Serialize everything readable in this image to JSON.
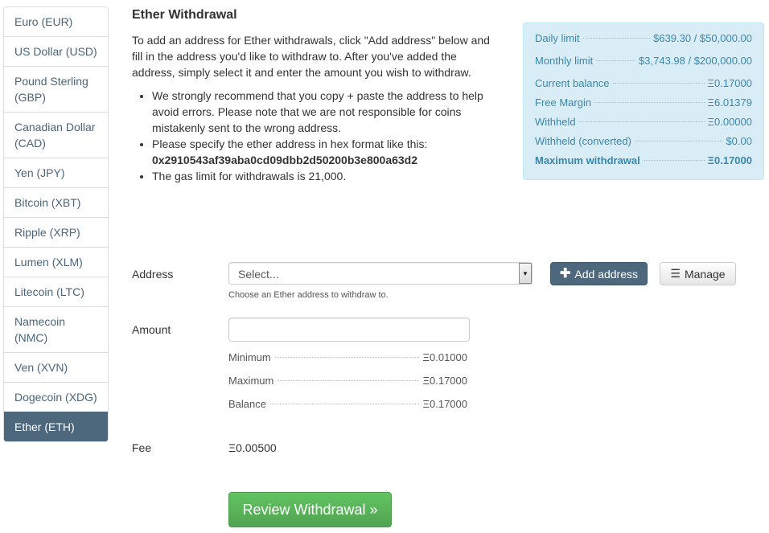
{
  "sidebar": {
    "items": [
      {
        "label": "Euro (EUR)",
        "active": false
      },
      {
        "label": "US Dollar (USD)",
        "active": false
      },
      {
        "label": "Pound Sterling (GBP)",
        "active": false
      },
      {
        "label": "Canadian Dollar (CAD)",
        "active": false
      },
      {
        "label": "Yen (JPY)",
        "active": false
      },
      {
        "label": "Bitcoin (XBT)",
        "active": false
      },
      {
        "label": "Ripple (XRP)",
        "active": false
      },
      {
        "label": "Lumen (XLM)",
        "active": false
      },
      {
        "label": "Litecoin (LTC)",
        "active": false
      },
      {
        "label": "Namecoin (NMC)",
        "active": false
      },
      {
        "label": "Ven (XVN)",
        "active": false
      },
      {
        "label": "Dogecoin (XDG)",
        "active": false
      },
      {
        "label": "Ether (ETH)",
        "active": true
      }
    ]
  },
  "main": {
    "title": "Ether Withdrawal",
    "intro": "To add an address for Ether withdrawals, click \"Add address\" below and fill in the address you'd like to withdraw to. After you've added the address, simply select it and enter the amount you wish to withdraw.",
    "bullets": {
      "b1": "We strongly recommend that you copy + paste the address to help avoid errors. Please note that we are not responsible for coins mistakenly sent to the wrong address.",
      "b2": "Please specify the ether address in hex format like this:",
      "b2_hex": "0x2910543af39aba0cd09dbb2d50200b3e800a63d2",
      "b3": "The gas limit for withdrawals is 21,000."
    }
  },
  "limits": {
    "rows": [
      {
        "label": "Daily limit",
        "value": "$639.30 / $50,000.00"
      },
      {
        "label": "Monthly limit",
        "value": "$3,743.98 / $200,000.00"
      },
      {
        "label": "Current balance",
        "value": "Ξ0.17000"
      },
      {
        "label": "Free Margin",
        "value": "Ξ6.01379"
      },
      {
        "label": "Withheld",
        "value": "Ξ0.00000"
      },
      {
        "label": "Withheld (converted)",
        "value": "$0.00"
      },
      {
        "label": "Maximum withdrawal",
        "value": "Ξ0.17000"
      }
    ]
  },
  "form": {
    "address_label": "Address",
    "address_select_value": "Select...",
    "address_help": "Choose an Ether address to withdraw to.",
    "add_address_label": "Add address",
    "manage_label": "Manage",
    "amount_label": "Amount",
    "amount_value": "",
    "minmax": [
      {
        "label": "Minimum",
        "value": "Ξ0.01000"
      },
      {
        "label": "Maximum",
        "value": "Ξ0.17000"
      },
      {
        "label": "Balance",
        "value": "Ξ0.17000"
      }
    ],
    "fee_label": "Fee",
    "fee_value": "Ξ0.00500",
    "review_label": "Review Withdrawal »"
  },
  "icons": {
    "plus": "plus-icon",
    "list": "list-icon",
    "caret": "caret-down-icon"
  },
  "colors": {
    "sidebar_active_bg": "#4d687c",
    "info_panel_bg": "#d9edf7",
    "info_panel_text": "#3a87ad",
    "review_button": "#5cb85c"
  }
}
